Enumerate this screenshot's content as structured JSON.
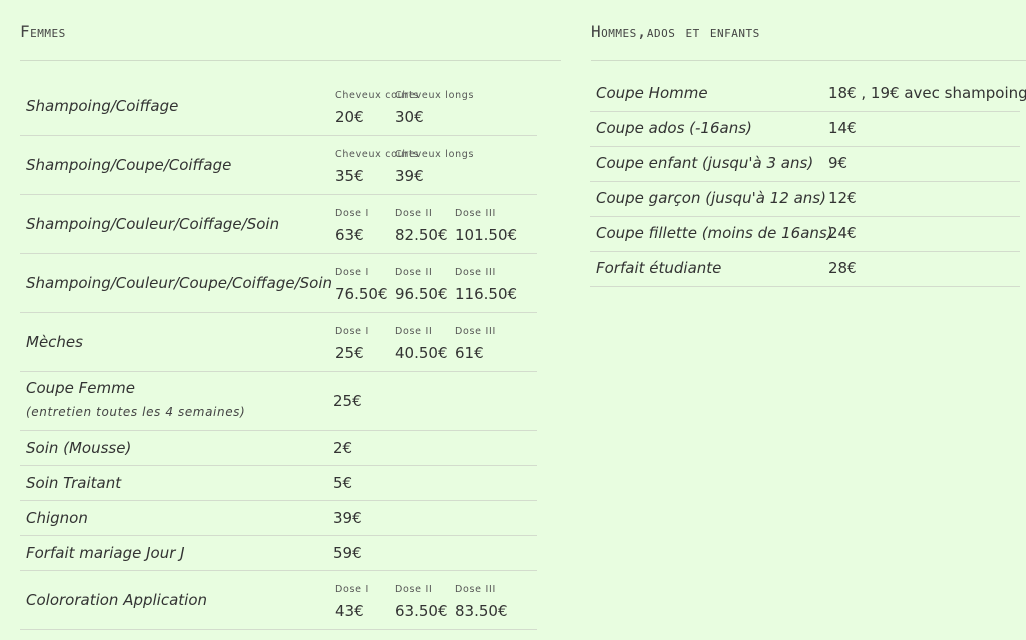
{
  "femmes": {
    "title": "Femmes",
    "rows": [
      {
        "label": "Shampoing/Coiffage",
        "cells": [
          {
            "caption": "Cheveux courts",
            "price": "20€"
          },
          {
            "caption": "Cheveux longs",
            "price": "30€"
          }
        ]
      },
      {
        "label": "Shampoing/Coupe/Coiffage",
        "cells": [
          {
            "caption": "Cheveux courts",
            "price": "35€"
          },
          {
            "caption": "Cheveux longs",
            "price": "39€"
          }
        ]
      },
      {
        "label": "Shampoing/Couleur/Coiffage/Soin",
        "cells": [
          {
            "caption": "Dose I",
            "price": "63€"
          },
          {
            "caption": "Dose II",
            "price": "82.50€"
          },
          {
            "caption": "Dose III",
            "price": "101.50€"
          }
        ]
      },
      {
        "label": "Shampoing/Couleur/Coupe/Coiffage/Soin",
        "cells": [
          {
            "caption": "Dose I",
            "price": "76.50€"
          },
          {
            "caption": "Dose II",
            "price": "96.50€"
          },
          {
            "caption": "Dose III",
            "price": "116.50€"
          }
        ]
      },
      {
        "label": "Mèches",
        "cells": [
          {
            "caption": "Dose I",
            "price": "25€"
          },
          {
            "caption": "Dose II",
            "price": "40.50€"
          },
          {
            "caption": "Dose III",
            "price": "61€"
          }
        ]
      },
      {
        "label": "Coupe Femme",
        "sublabel": "(entretien toutes les 4 semaines)",
        "price": "25€"
      },
      {
        "label": "Soin (Mousse)",
        "price": "2€"
      },
      {
        "label": "Soin Traitant",
        "price": "5€"
      },
      {
        "label": "Chignon",
        "price": "39€"
      },
      {
        "label": "Forfait mariage Jour J",
        "price": "59€"
      },
      {
        "label": "Colororation Application",
        "cells": [
          {
            "caption": "Dose I",
            "price": "43€"
          },
          {
            "caption": "Dose II",
            "price": "63.50€"
          },
          {
            "caption": "Dose III",
            "price": "83.50€"
          }
        ]
      }
    ]
  },
  "hommes": {
    "title": "Hommes,ados et enfants",
    "rows": [
      {
        "label": "Coupe Homme",
        "price": "18€ , 19€ avec shampoing"
      },
      {
        "label": "Coupe ados (-16ans)",
        "price": "14€"
      },
      {
        "label": "Coupe enfant (jusqu'à 3 ans)",
        "price": "9€"
      },
      {
        "label": "Coupe garçon (jusqu'à 12 ans)",
        "price": "12€"
      },
      {
        "label": "Coupe fillette (moins de 16ans)",
        "price": "24€"
      },
      {
        "label": "Forfait étudiante",
        "price": "28€"
      }
    ]
  }
}
